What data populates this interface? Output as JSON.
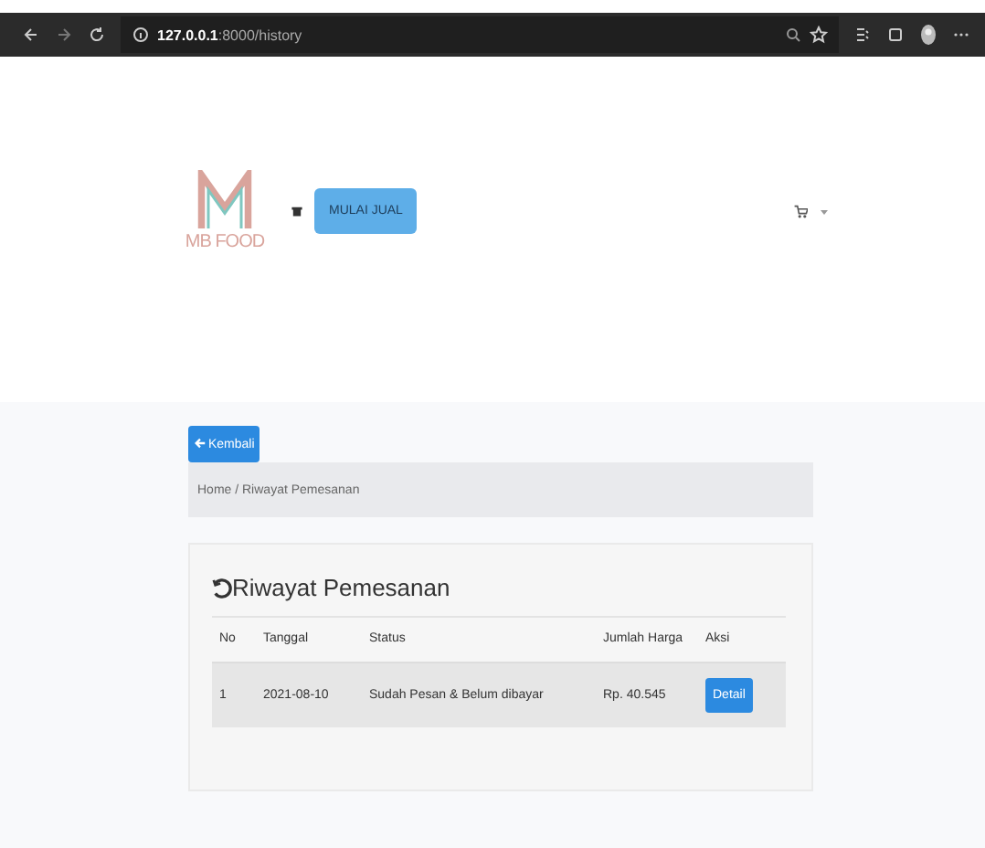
{
  "browser": {
    "url_host": "127.0.0.1",
    "url_path": ":8000/history"
  },
  "header": {
    "logo_text": "MB FOOD",
    "sell_button": "MULAI JUAL"
  },
  "back_button": "Kembali",
  "breadcrumb": "Home / Riwayat Pemesanan",
  "card": {
    "title": "Riwayat Pemesanan",
    "columns": [
      "No",
      "Tanggal",
      "Status",
      "Jumlah Harga",
      "Aksi"
    ],
    "rows": [
      {
        "no": "1",
        "date": "2021-08-10",
        "status": "Sudah Pesan & Belum dibayar",
        "total": "Rp. 40.545",
        "action": "Detail"
      }
    ]
  }
}
